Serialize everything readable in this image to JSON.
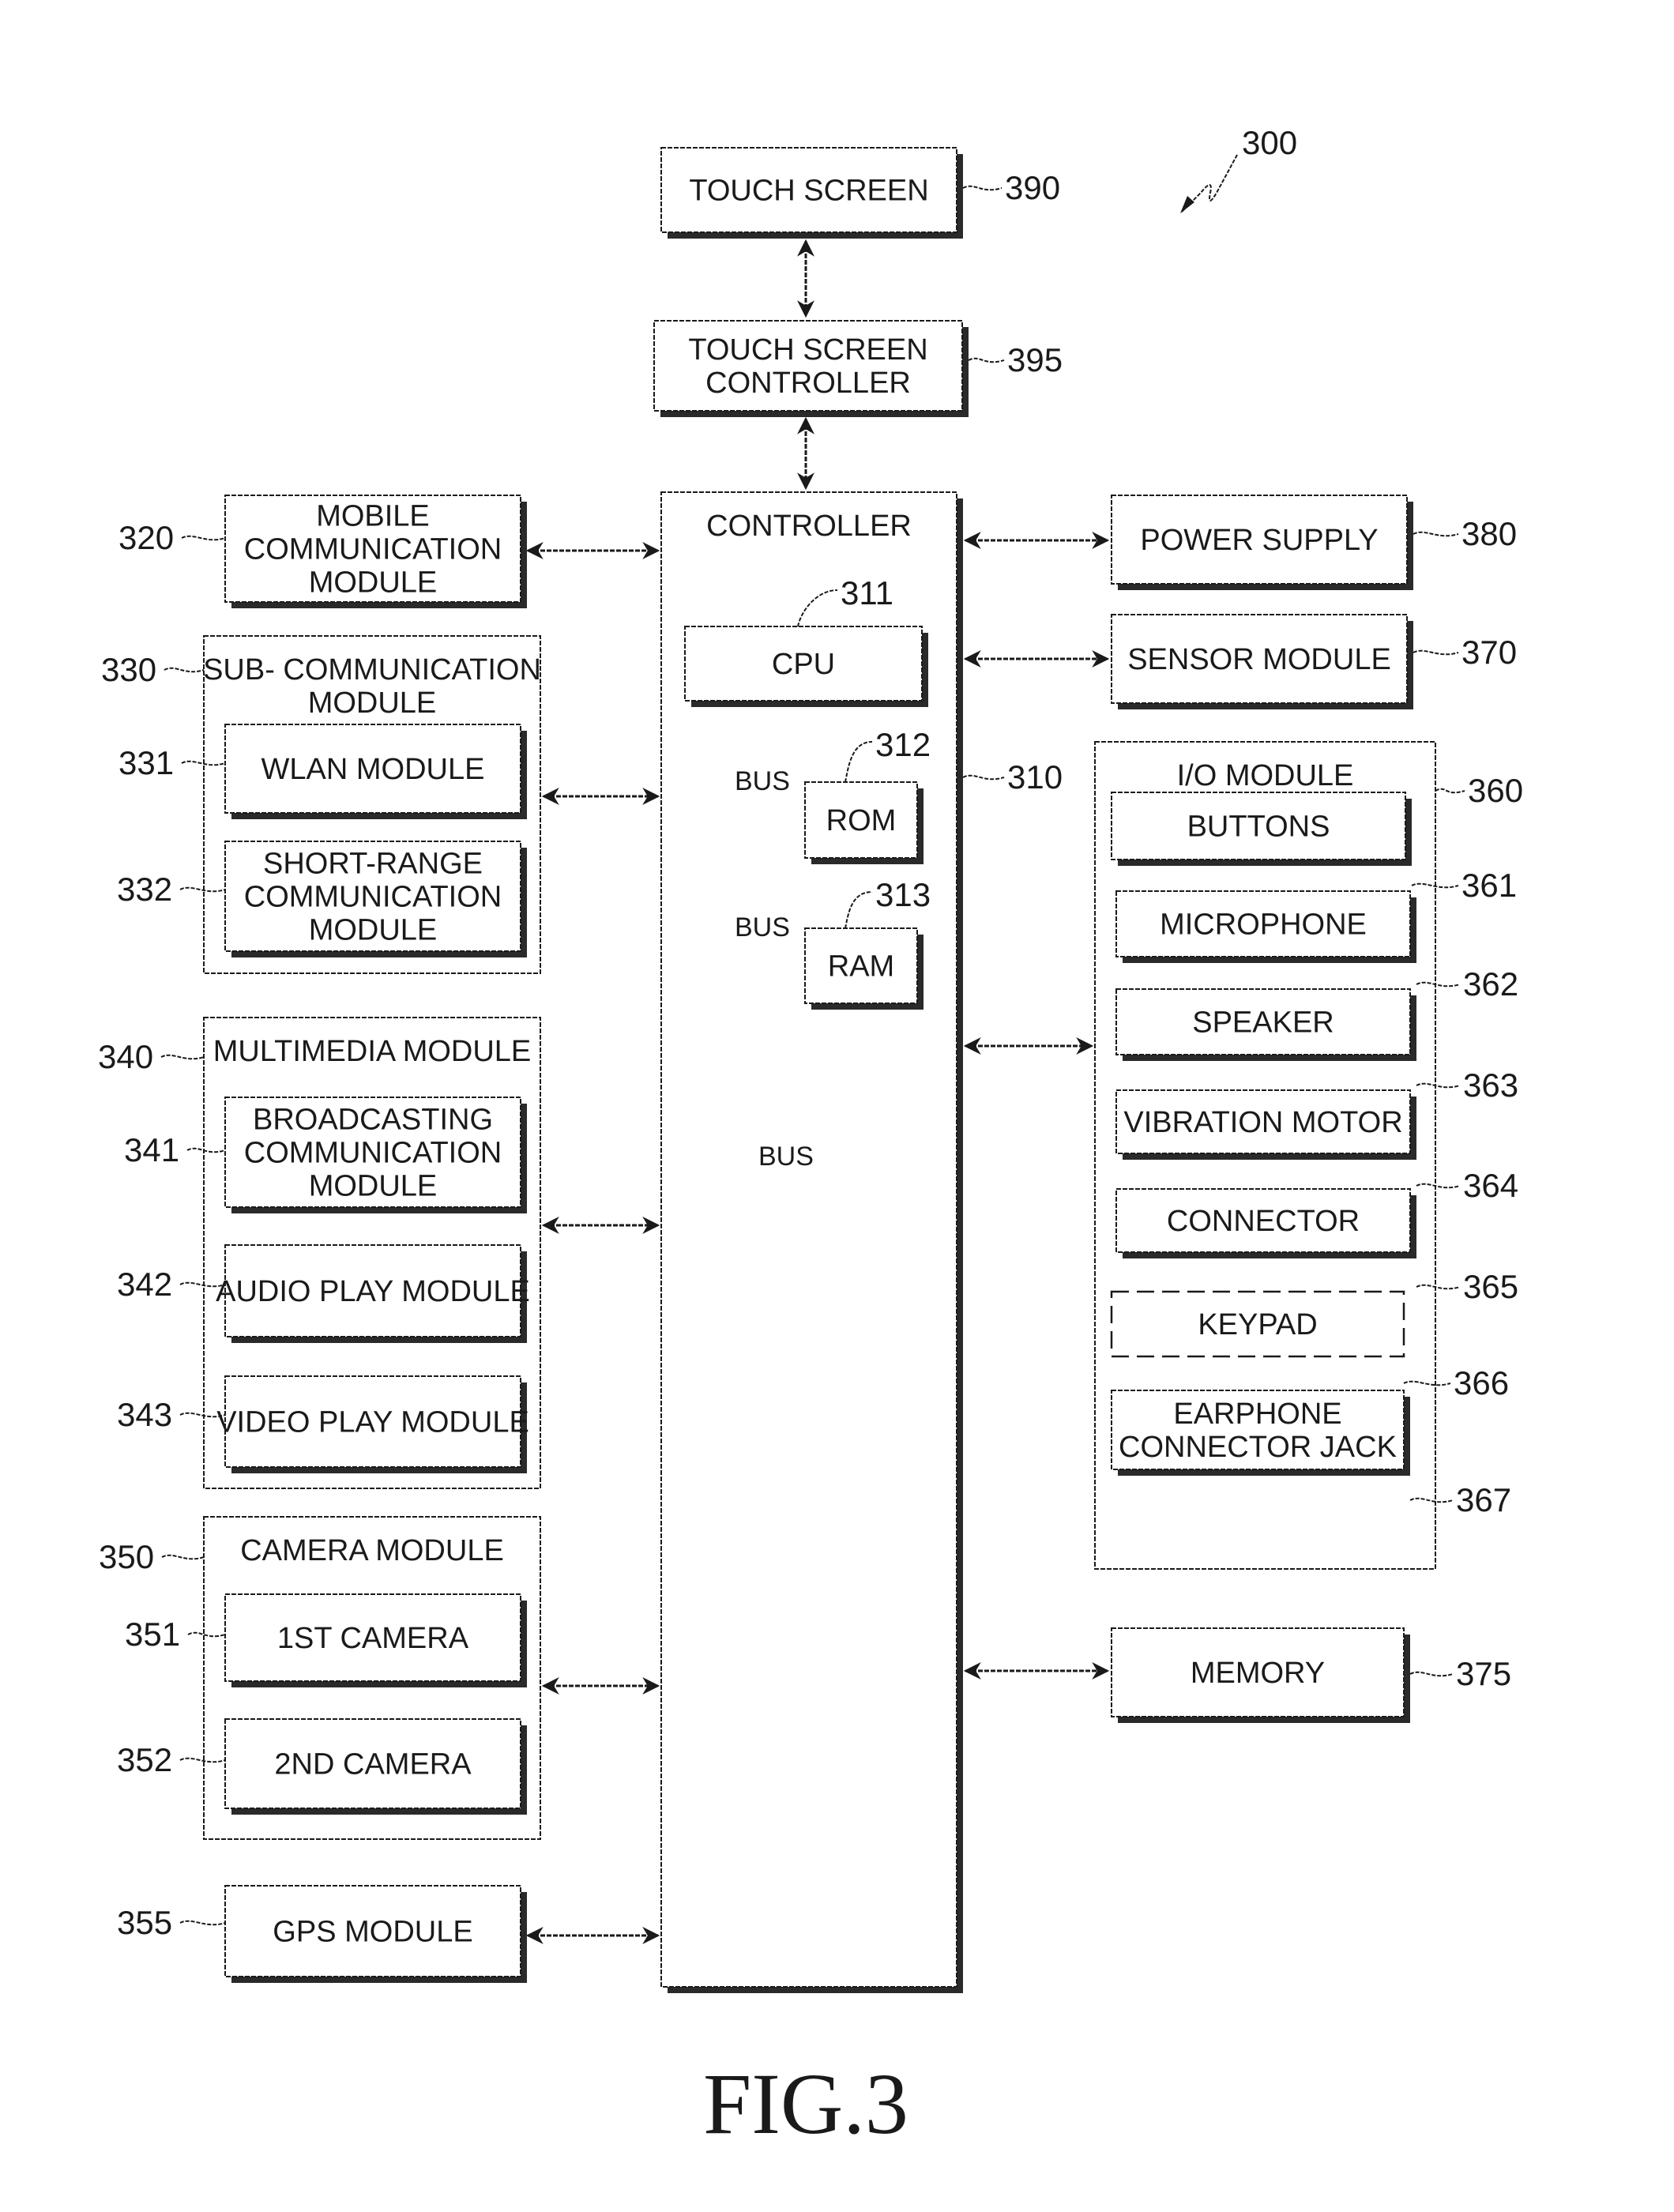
{
  "figure": {
    "caption": "FIG.3",
    "device_ref": "300"
  },
  "blocks": {
    "touch_screen": {
      "label": [
        "TOUCH SCREEN"
      ],
      "ref": "390"
    },
    "touch_screen_controller": {
      "label": [
        "TOUCH SCREEN",
        "CONTROLLER"
      ],
      "ref": "395"
    },
    "controller": {
      "label": [
        "CONTROLLER"
      ],
      "ref": "310"
    },
    "cpu": {
      "label": [
        "CPU"
      ],
      "ref": "311"
    },
    "rom": {
      "label": [
        "ROM"
      ],
      "ref": "312"
    },
    "ram": {
      "label": [
        "RAM"
      ],
      "ref": "313"
    },
    "bus_rom": {
      "label": [
        "BUS"
      ]
    },
    "bus_ram": {
      "label": [
        "BUS"
      ]
    },
    "bus_main": {
      "label": [
        "BUS"
      ]
    },
    "mobile_comm": {
      "label": [
        "MOBILE",
        "COMMUNICATION",
        "MODULE"
      ],
      "ref": "320"
    },
    "sub_comm": {
      "label": [
        "SUB- COMMUNICATION",
        "MODULE"
      ],
      "ref": "330"
    },
    "wlan": {
      "label": [
        "WLAN MODULE"
      ],
      "ref": "331"
    },
    "short_range": {
      "label": [
        "SHORT-RANGE",
        "COMMUNICATION",
        "MODULE"
      ],
      "ref": "332"
    },
    "multimedia": {
      "label": [
        "MULTIMEDIA MODULE"
      ],
      "ref": "340"
    },
    "broadcasting": {
      "label": [
        "BROADCASTING",
        "COMMUNICATION",
        "MODULE"
      ],
      "ref": "341"
    },
    "audio_play": {
      "label": [
        "AUDIO PLAY MODULE"
      ],
      "ref": "342"
    },
    "video_play": {
      "label": [
        "VIDEO PLAY MODULE"
      ],
      "ref": "343"
    },
    "camera": {
      "label": [
        "CAMERA MODULE"
      ],
      "ref": "350"
    },
    "camera_1": {
      "label": [
        "1ST CAMERA"
      ],
      "ref": "351"
    },
    "camera_2": {
      "label": [
        "2ND CAMERA"
      ],
      "ref": "352"
    },
    "gps": {
      "label": [
        "GPS MODULE"
      ],
      "ref": "355"
    },
    "power_supply": {
      "label": [
        "POWER SUPPLY"
      ],
      "ref": "380"
    },
    "sensor": {
      "label": [
        "SENSOR MODULE"
      ],
      "ref": "370"
    },
    "io": {
      "label": [
        "I/O MODULE"
      ],
      "ref": "360"
    },
    "buttons": {
      "label": [
        "BUTTONS"
      ],
      "ref": "361"
    },
    "microphone": {
      "label": [
        "MICROPHONE"
      ],
      "ref": "362"
    },
    "speaker": {
      "label": [
        "SPEAKER"
      ],
      "ref": "363"
    },
    "vibration_motor": {
      "label": [
        "VIBRATION MOTOR"
      ],
      "ref": "364"
    },
    "connector": {
      "label": [
        "CONNECTOR"
      ],
      "ref": "365"
    },
    "keypad": {
      "label": [
        "KEYPAD"
      ],
      "ref": "366",
      "optional": true
    },
    "earphone_jack": {
      "label": [
        "EARPHONE",
        "CONNECTOR JACK"
      ],
      "ref": "367"
    },
    "memory": {
      "label": [
        "MEMORY"
      ],
      "ref": "375"
    }
  },
  "connections": [
    {
      "from": "touch_screen",
      "to": "touch_screen_controller",
      "type": "bidirectional"
    },
    {
      "from": "touch_screen_controller",
      "to": "controller",
      "type": "bidirectional"
    },
    {
      "from": "mobile_comm",
      "to": "controller",
      "type": "bidirectional"
    },
    {
      "from": "sub_comm",
      "to": "controller",
      "type": "bidirectional"
    },
    {
      "from": "multimedia",
      "to": "controller",
      "type": "bidirectional"
    },
    {
      "from": "camera",
      "to": "controller",
      "type": "bidirectional"
    },
    {
      "from": "gps",
      "to": "controller",
      "type": "bidirectional"
    },
    {
      "from": "controller",
      "to": "power_supply",
      "type": "bidirectional"
    },
    {
      "from": "controller",
      "to": "sensor",
      "type": "bidirectional"
    },
    {
      "from": "controller",
      "to": "io",
      "type": "bidirectional"
    },
    {
      "from": "controller",
      "to": "memory",
      "type": "bidirectional"
    },
    {
      "from": "cpu",
      "to": "rom",
      "type": "bidirectional",
      "via": "BUS"
    },
    {
      "from": "cpu",
      "to": "ram",
      "type": "bidirectional",
      "via": "BUS"
    },
    {
      "from": "cpu",
      "to": "bus",
      "type": "unidirectional",
      "via": "BUS"
    }
  ]
}
